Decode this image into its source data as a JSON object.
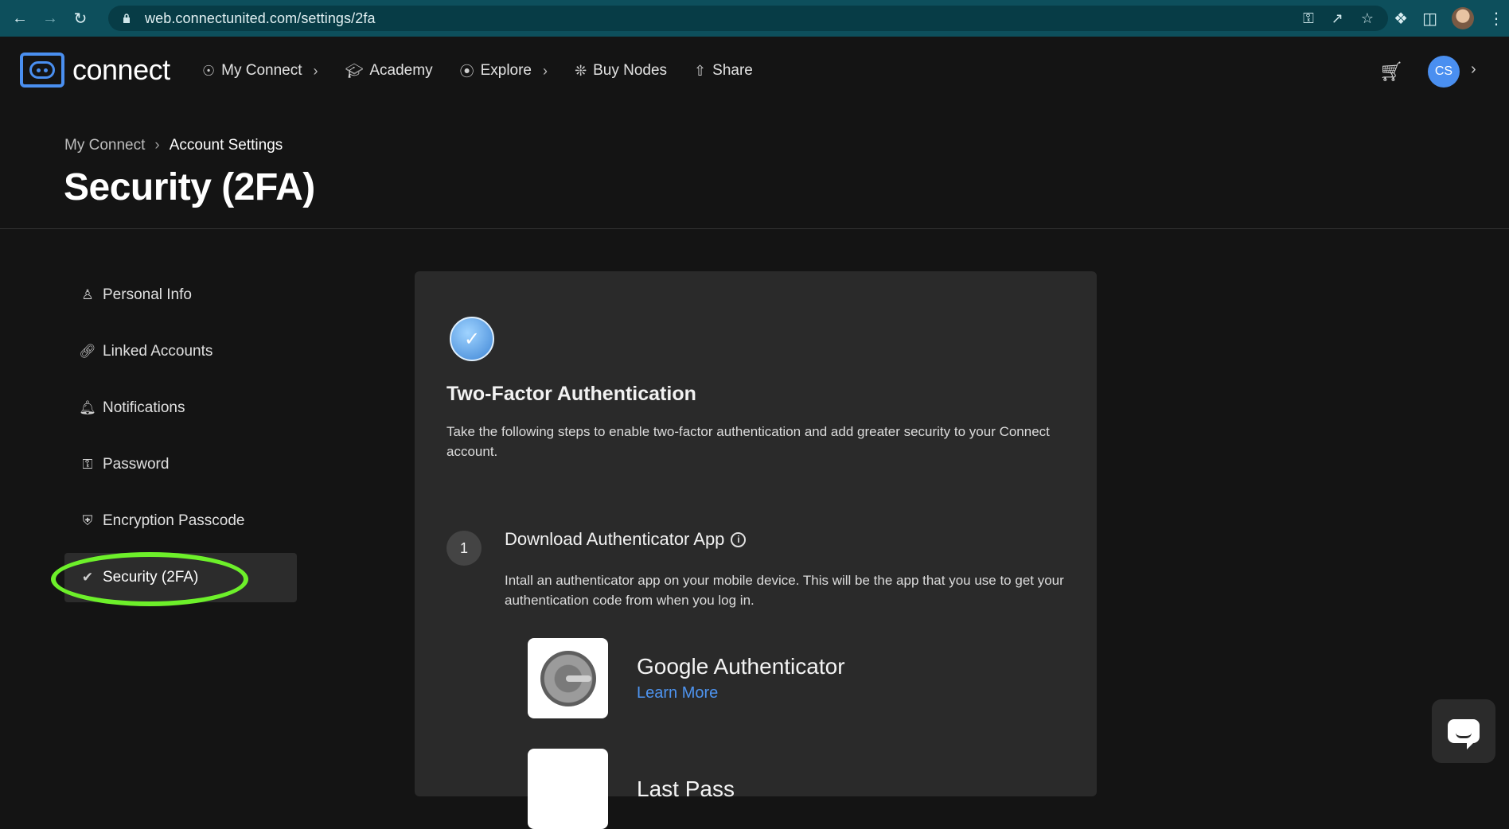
{
  "browser": {
    "url": "web.connectunited.com/settings/2fa",
    "back_icon": "arrow-left",
    "forward_icon": "arrow-right",
    "reload_icon": "reload"
  },
  "header": {
    "logo_text": "connect",
    "nav": [
      {
        "label": "My Connect",
        "icon": "eye-icon",
        "has_chevron": true
      },
      {
        "label": "Academy",
        "icon": "graduation-cap-icon",
        "has_chevron": false
      },
      {
        "label": "Explore",
        "icon": "compass-icon",
        "has_chevron": true
      },
      {
        "label": "Buy Nodes",
        "icon": "nodes-icon",
        "has_chevron": false
      },
      {
        "label": "Share",
        "icon": "share-icon",
        "has_chevron": false
      }
    ],
    "avatar_initials": "CS",
    "accent_color": "#4a8ff0"
  },
  "breadcrumb": {
    "parent": "My Connect",
    "current": "Account Settings"
  },
  "page_title": "Security (2FA)",
  "sidebar": {
    "items": [
      {
        "label": "Personal Info",
        "icon": "person-icon",
        "active": false
      },
      {
        "label": "Linked Accounts",
        "icon": "link-icon",
        "active": false
      },
      {
        "label": "Notifications",
        "icon": "bell-icon",
        "active": false
      },
      {
        "label": "Password",
        "icon": "key-icon",
        "active": false
      },
      {
        "label": "Encryption Passcode",
        "icon": "shield-icon",
        "active": false
      },
      {
        "label": "Security (2FA)",
        "icon": "check-badge-icon",
        "active": true
      }
    ],
    "highlight_color": "#6df02a"
  },
  "card": {
    "title": "Two-Factor Authentication",
    "description": "Take the following steps to enable two-factor authentication and add greater security to your Connect account.",
    "step": {
      "number": "1",
      "title": "Download Authenticator App",
      "description": "Intall an authenticator app on your mobile device. This will be the app that you use to get your authentication code from when you log in."
    },
    "apps": [
      {
        "name": "Google Authenticator",
        "link": "Learn More"
      },
      {
        "name": "Last Pass",
        "link": ""
      }
    ],
    "link_color": "#4e94f0"
  }
}
